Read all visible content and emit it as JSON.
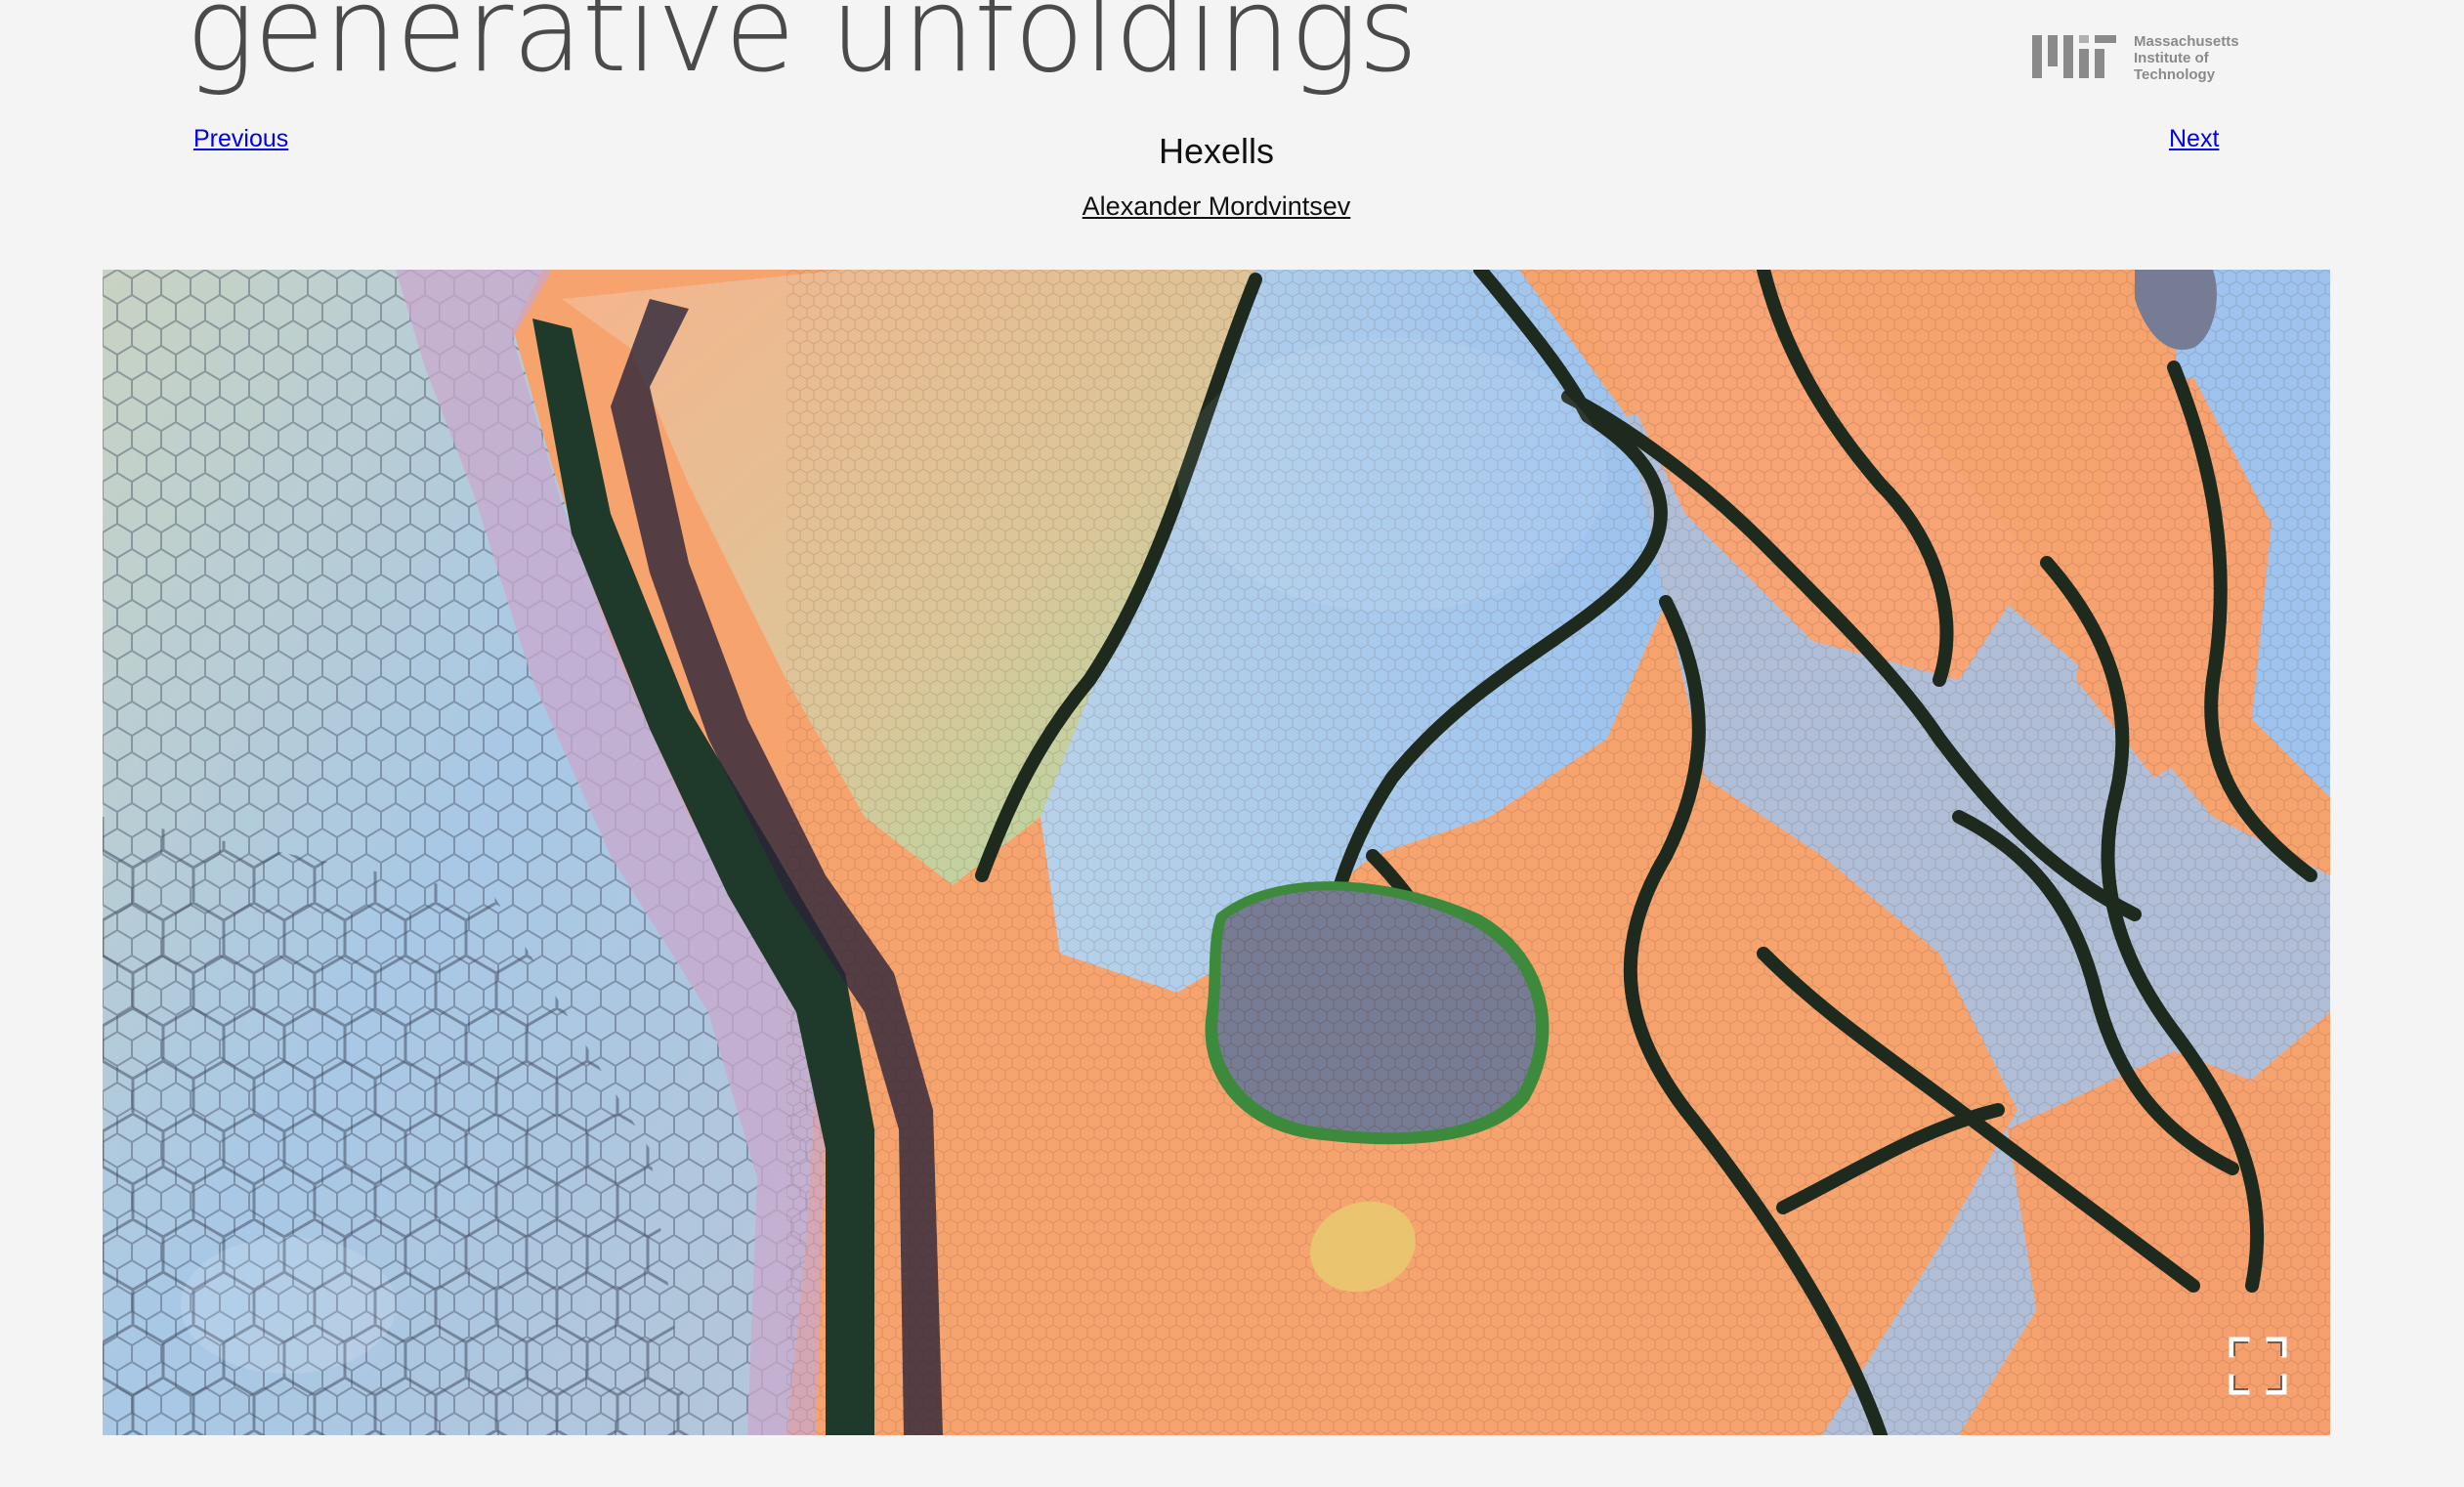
{
  "site": {
    "title": "generative unfoldings",
    "institution_lines": [
      "Massachusetts",
      "Institute of",
      "Technology"
    ]
  },
  "nav": {
    "previous": "Previous",
    "next": "Next"
  },
  "artwork": {
    "title": "Hexells",
    "author": "Alexander Mordvintsev"
  },
  "colors": {
    "background": "#f4f4f4",
    "link": "#0000ee",
    "title_text": "#4a4a4a",
    "orange_region": "#f7a36e",
    "blue_region": "#a9c7ea",
    "dark_line": "#1d2a1d",
    "gray_blob": "#767c94",
    "mint_region": "#b8d9b4"
  },
  "icons": {
    "logo": "mit-logo",
    "fullscreen": "fullscreen-icon"
  }
}
